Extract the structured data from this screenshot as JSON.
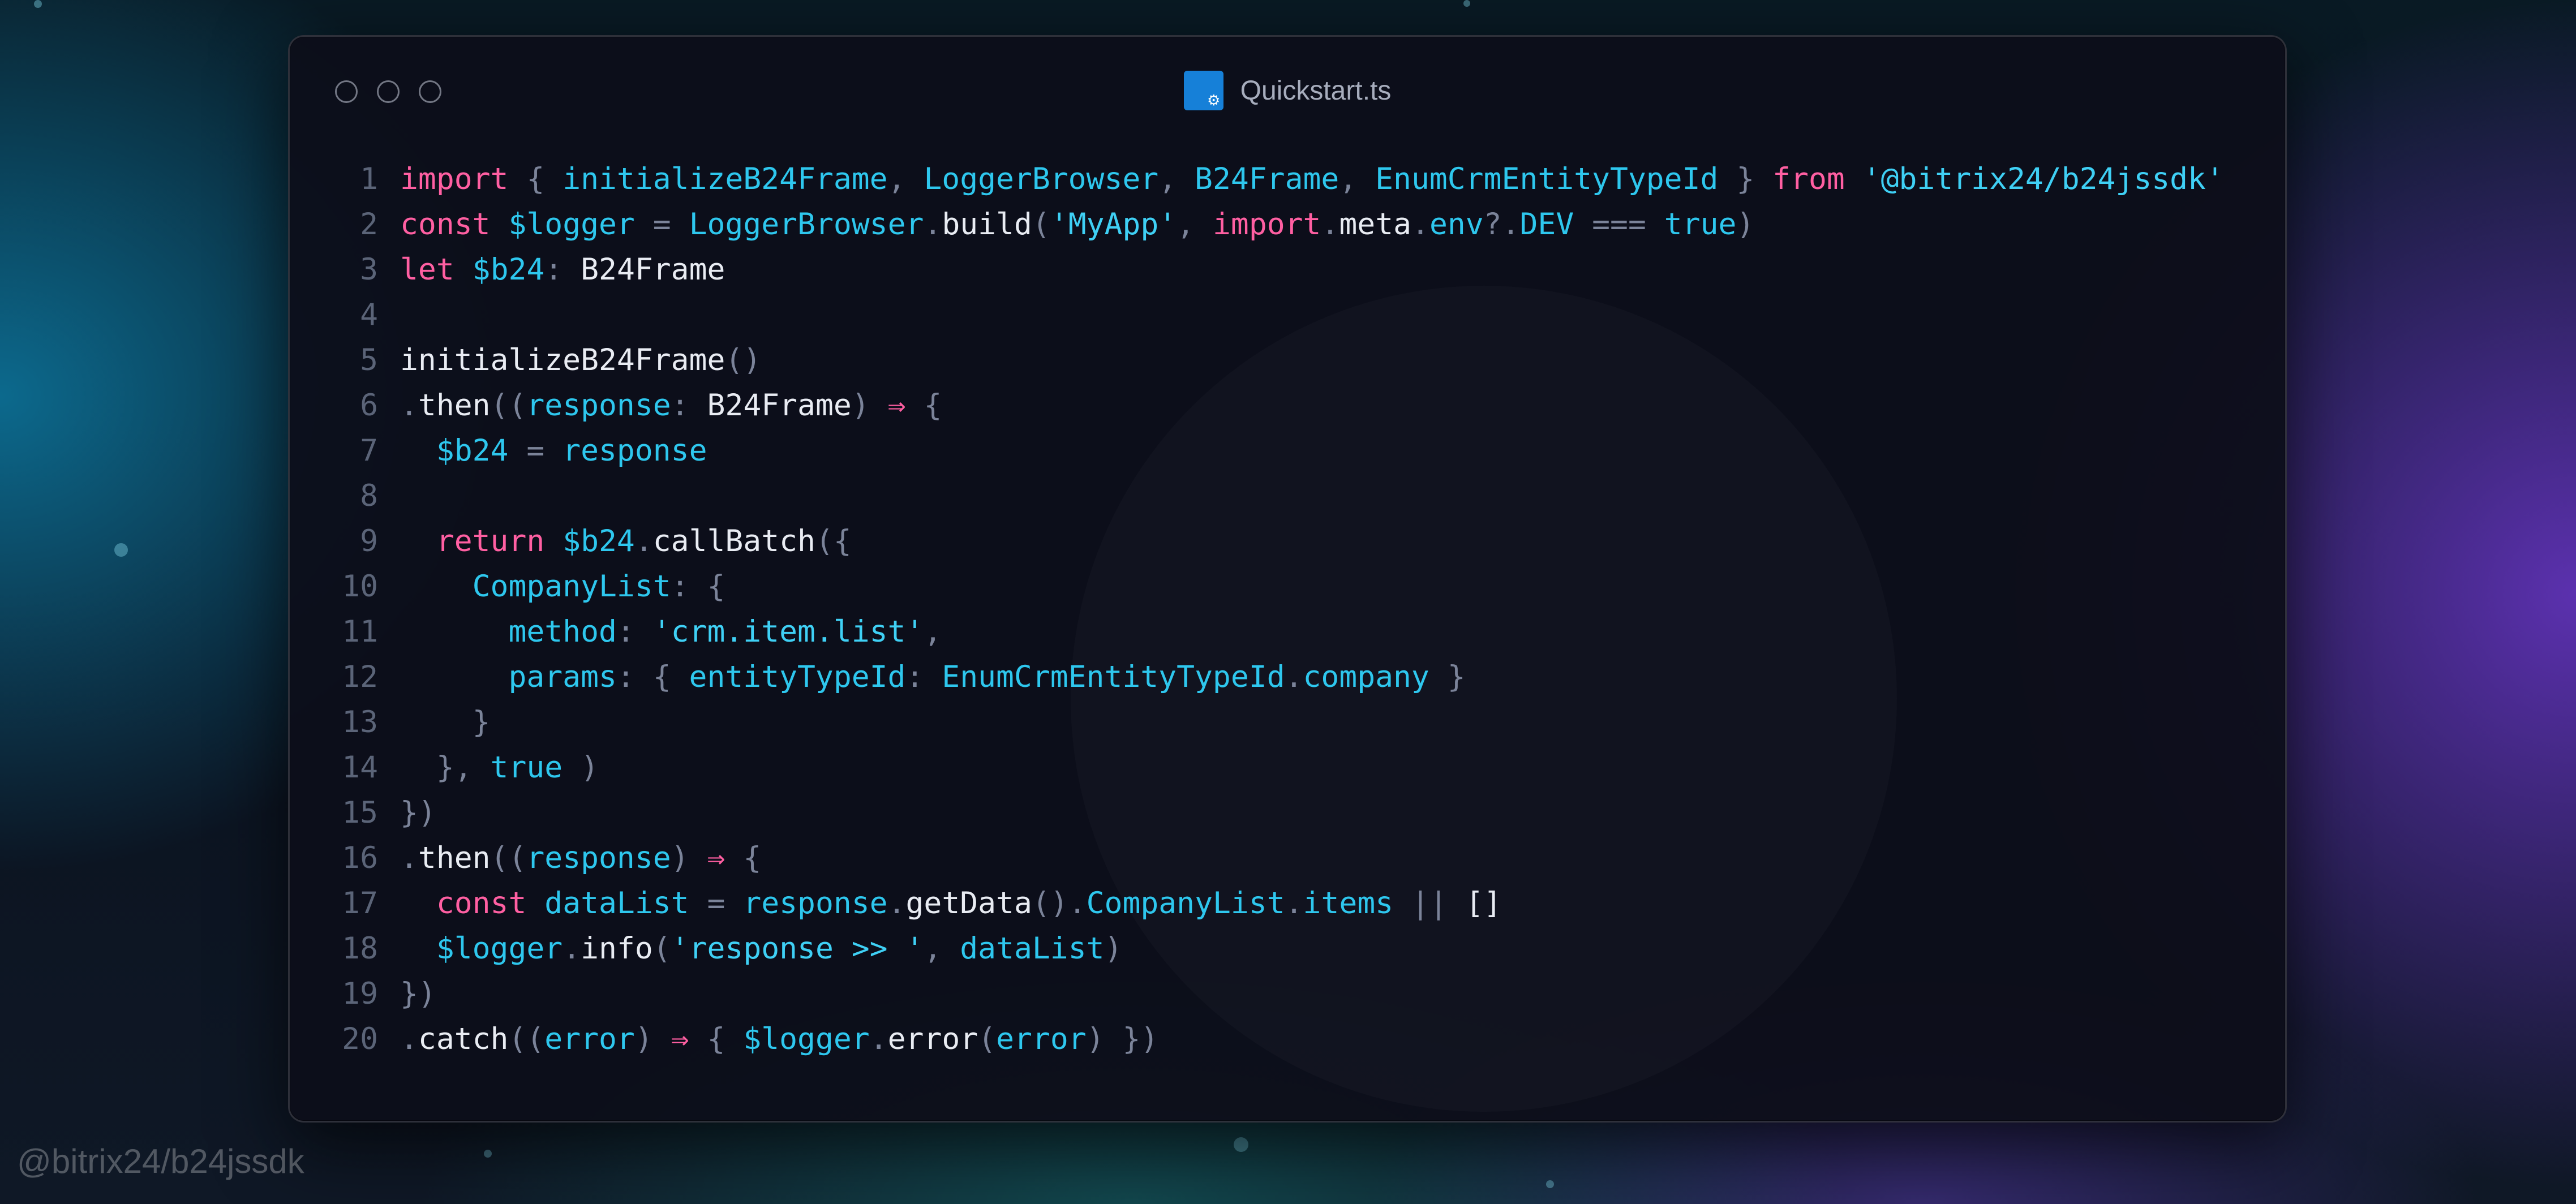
{
  "window": {
    "title": "Quickstart.ts",
    "file_icon": "typescript-file-icon"
  },
  "colors": {
    "keyword": "#ff5fa2",
    "identifier": "#2ec7ee",
    "plain": "#e9ecf3",
    "punctuation": "#7b8399",
    "string": "#3fd0f5"
  },
  "code_lines": [
    [
      [
        "kw",
        "import"
      ],
      [
        "pu",
        " { "
      ],
      [
        "id",
        "initializeB24Frame"
      ],
      [
        "pu",
        ", "
      ],
      [
        "id",
        "LoggerBrowser"
      ],
      [
        "pu",
        ", "
      ],
      [
        "id",
        "B24Frame"
      ],
      [
        "pu",
        ", "
      ],
      [
        "id",
        "EnumCrmEntityTypeId"
      ],
      [
        "pu",
        " } "
      ],
      [
        "kw",
        "from"
      ],
      [
        "pu",
        " "
      ],
      [
        "st",
        "'@bitrix24/b24jssdk'"
      ]
    ],
    [
      [
        "kw",
        "const"
      ],
      [
        "pl",
        " "
      ],
      [
        "id",
        "$logger"
      ],
      [
        "pu",
        " = "
      ],
      [
        "id",
        "LoggerBrowser"
      ],
      [
        "pu",
        "."
      ],
      [
        "pl",
        "build"
      ],
      [
        "pu",
        "("
      ],
      [
        "st",
        "'MyApp'"
      ],
      [
        "pu",
        ", "
      ],
      [
        "kw",
        "import"
      ],
      [
        "pu",
        "."
      ],
      [
        "pl",
        "meta"
      ],
      [
        "pu",
        "."
      ],
      [
        "id",
        "env"
      ],
      [
        "pu",
        "?."
      ],
      [
        "id",
        "DEV"
      ],
      [
        "pu",
        " === "
      ],
      [
        "id",
        "true"
      ],
      [
        "pu",
        ")"
      ]
    ],
    [
      [
        "kw",
        "let"
      ],
      [
        "pl",
        " "
      ],
      [
        "id",
        "$b24"
      ],
      [
        "pu",
        ": "
      ],
      [
        "pl",
        "B24Frame"
      ]
    ],
    [],
    [
      [
        "pl",
        "initializeB24Frame"
      ],
      [
        "pu",
        "()"
      ]
    ],
    [
      [
        "pu",
        "."
      ],
      [
        "pl",
        "then"
      ],
      [
        "pu",
        "(("
      ],
      [
        "id",
        "response"
      ],
      [
        "pu",
        ": "
      ],
      [
        "pl",
        "B24Frame"
      ],
      [
        "pu",
        ") "
      ],
      [
        "kw",
        "⇒"
      ],
      [
        "pu",
        " {"
      ]
    ],
    [
      [
        "pl",
        "  "
      ],
      [
        "id",
        "$b24"
      ],
      [
        "pu",
        " = "
      ],
      [
        "id",
        "response"
      ]
    ],
    [],
    [
      [
        "pl",
        "  "
      ],
      [
        "kw",
        "return"
      ],
      [
        "pl",
        " "
      ],
      [
        "id",
        "$b24"
      ],
      [
        "pu",
        "."
      ],
      [
        "pl",
        "callBatch"
      ],
      [
        "pu",
        "({"
      ]
    ],
    [
      [
        "pl",
        "    "
      ],
      [
        "id",
        "CompanyList"
      ],
      [
        "pu",
        ": {"
      ]
    ],
    [
      [
        "pl",
        "      "
      ],
      [
        "id",
        "method"
      ],
      [
        "pu",
        ": "
      ],
      [
        "st",
        "'crm.item.list'"
      ],
      [
        "pu",
        ","
      ]
    ],
    [
      [
        "pl",
        "      "
      ],
      [
        "id",
        "params"
      ],
      [
        "pu",
        ": { "
      ],
      [
        "id",
        "entityTypeId"
      ],
      [
        "pu",
        ": "
      ],
      [
        "id",
        "EnumCrmEntityTypeId"
      ],
      [
        "pu",
        "."
      ],
      [
        "id",
        "company"
      ],
      [
        "pu",
        " }"
      ]
    ],
    [
      [
        "pu",
        "    }"
      ]
    ],
    [
      [
        "pu",
        "  }, "
      ],
      [
        "id",
        "true"
      ],
      [
        "pu",
        " )"
      ]
    ],
    [
      [
        "pu",
        "})"
      ]
    ],
    [
      [
        "pu",
        "."
      ],
      [
        "pl",
        "then"
      ],
      [
        "pu",
        "(("
      ],
      [
        "id",
        "response"
      ],
      [
        "pu",
        ") "
      ],
      [
        "kw",
        "⇒"
      ],
      [
        "pu",
        " {"
      ]
    ],
    [
      [
        "pl",
        "  "
      ],
      [
        "kw",
        "const"
      ],
      [
        "pl",
        " "
      ],
      [
        "id",
        "dataList"
      ],
      [
        "pu",
        " = "
      ],
      [
        "id",
        "response"
      ],
      [
        "pu",
        "."
      ],
      [
        "pl",
        "getData"
      ],
      [
        "pu",
        "()."
      ],
      [
        "id",
        "CompanyList"
      ],
      [
        "pu",
        "."
      ],
      [
        "id",
        "items"
      ],
      [
        "pu",
        " || "
      ],
      [
        "pl",
        "[]"
      ]
    ],
    [
      [
        "pl",
        "  "
      ],
      [
        "id",
        "$logger"
      ],
      [
        "pu",
        "."
      ],
      [
        "pl",
        "info"
      ],
      [
        "pu",
        "("
      ],
      [
        "st",
        "'response >> '"
      ],
      [
        "pu",
        ", "
      ],
      [
        "id",
        "dataList"
      ],
      [
        "pu",
        ")"
      ]
    ],
    [
      [
        "pu",
        "})"
      ]
    ],
    [
      [
        "pu",
        "."
      ],
      [
        "pl",
        "catch"
      ],
      [
        "pu",
        "(("
      ],
      [
        "id",
        "error"
      ],
      [
        "pu",
        ") "
      ],
      [
        "kw",
        "⇒"
      ],
      [
        "pu",
        " { "
      ],
      [
        "id",
        "$logger"
      ],
      [
        "pu",
        "."
      ],
      [
        "pl",
        "error"
      ],
      [
        "pu",
        "("
      ],
      [
        "id",
        "error"
      ],
      [
        "pu",
        ") })"
      ]
    ]
  ],
  "watermark": "@bitrix24/b24jssdk"
}
